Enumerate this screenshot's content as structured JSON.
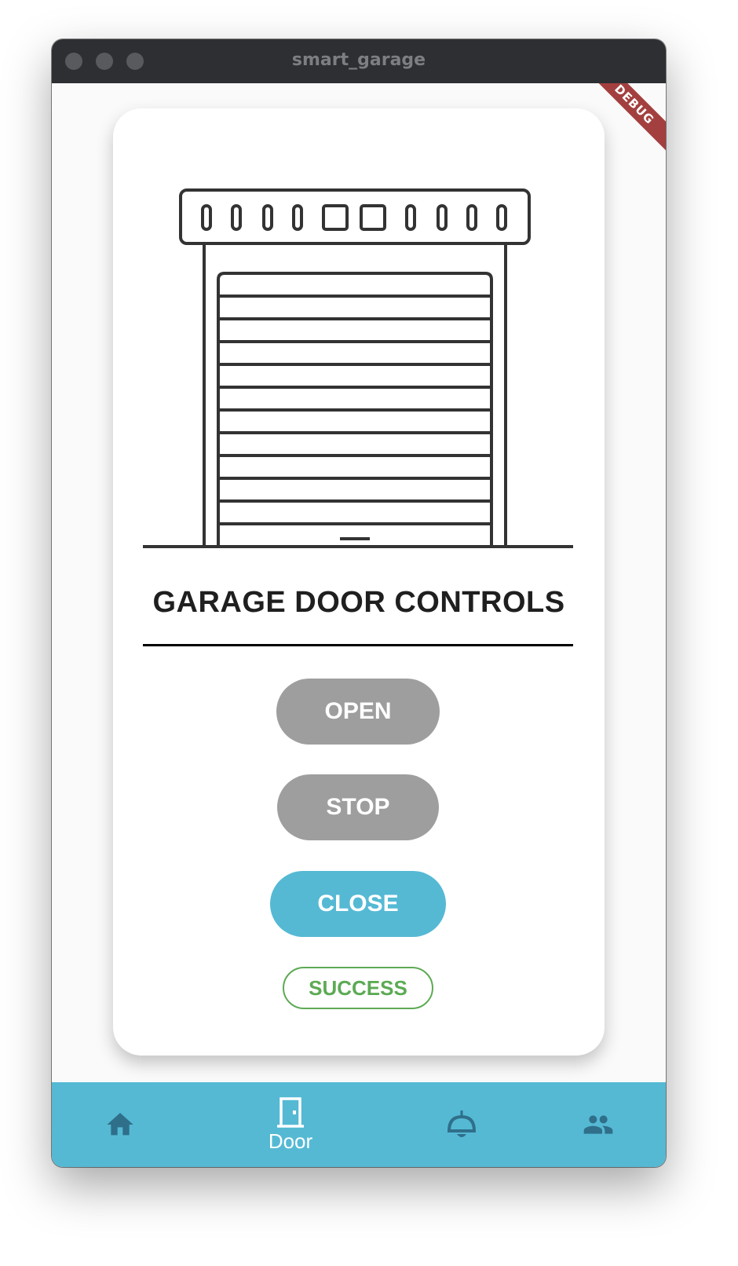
{
  "window": {
    "title": "smart_garage"
  },
  "debug_banner": "DEBUG",
  "card": {
    "title": "GARAGE DOOR CONTROLS",
    "buttons": {
      "open": "OPEN",
      "stop": "STOP",
      "close": "CLOSE"
    },
    "status": "SUCCESS"
  },
  "nav": {
    "items": [
      {
        "icon": "home-icon",
        "label": ""
      },
      {
        "icon": "door-icon",
        "label": "Door"
      },
      {
        "icon": "bell-icon",
        "label": ""
      },
      {
        "icon": "people-icon",
        "label": ""
      }
    ]
  },
  "colors": {
    "accent": "#55b9d4",
    "inactive_button": "#9e9e9e",
    "success": "#5daa54",
    "titlebar": "#2e2f33",
    "nav_icon_inactive": "#2f6f8a"
  }
}
